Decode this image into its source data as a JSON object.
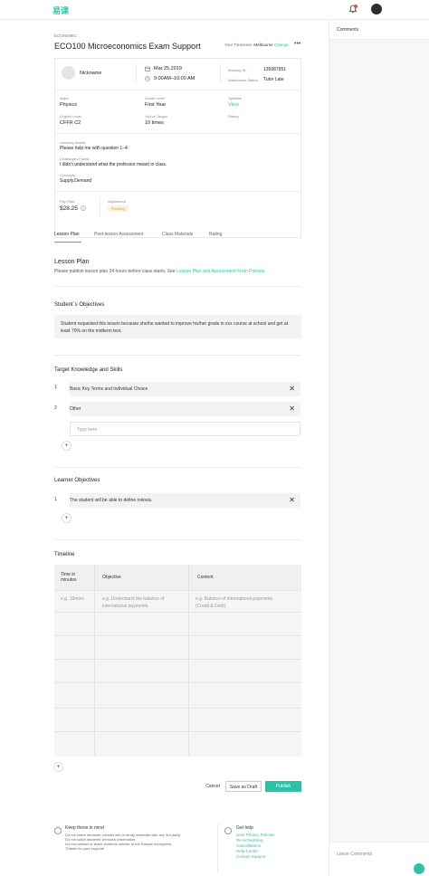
{
  "app": {
    "logo": "易课"
  },
  "header": {
    "breadcrumb": "ECONOMIC",
    "title": "ECO100 Microeconomics Exam Support",
    "timezone_label": "Your Timezone:",
    "timezone_value": "Melbourne",
    "timezone_change": "Change",
    "more": "•••"
  },
  "card": {
    "nickname": "Nickname",
    "date": "Mar 25,2019",
    "time": "9:00AM–10:00 AM",
    "booking_label": "Booking ID:",
    "booking_id": "135687951",
    "attendance_label": "Attendance Status:",
    "attendance": "Tutor Late",
    "major_label": "Major",
    "major": "Physics",
    "grade_label": "Grade Level",
    "grade": "First Year",
    "syllabus_label": "Syllabus",
    "syllabus": "View",
    "english_label": "English Level",
    "english": "CFFR C2",
    "taught_label": "You've Taught",
    "taught": "10 times",
    "rating_label": "Rating",
    "needs_label": "Learning Needs",
    "needs": "Please help me with question 1–4.",
    "challenges_label": "Challenges Faced",
    "challenges": "I didn’t understand what the professor meant in class.",
    "concepts_label": "Concepts",
    "concepts": "Supply,Demand",
    "pay_label": "Pay Rate",
    "pay": "$28.25",
    "adjust_label": "Adjustment",
    "adjust_status": "Pending"
  },
  "tabs": [
    "Lesson Plan",
    "Post-lesson Assessment",
    "Class Materials",
    "Rating"
  ],
  "lesson_plan": {
    "title": "Lesson Plan",
    "desc": "Please publish lesson plan 24 hours before class starts. See",
    "desc_link": "Lesson Plan and Assessment From Policies"
  },
  "objectives": {
    "title": "Student`s Objectives",
    "text": "Student requested this lesson because she/he wanted to improve his/her grade in xxx course at school and get at least 70% on the midterm test."
  },
  "knowledge": {
    "title": "Target Knowledge and Skills",
    "items": [
      {
        "num": "1",
        "text": "Basic Key Terms and Individual Choice"
      },
      {
        "num": "2",
        "text": "Other"
      }
    ],
    "placeholder": "Type here"
  },
  "learner": {
    "title": "Learner Objectives",
    "items": [
      {
        "num": "1",
        "text": "The student will be able to define mitosis."
      }
    ]
  },
  "timeline": {
    "title": "Timeline",
    "col_time": "Time in minutes",
    "col_objective": "Objective",
    "col_content": "Content",
    "ph_time": "e.g. 10mins",
    "ph_objective": "e.g. Understand the balance of international payments.",
    "ph_content": "e.g. Balance of international payments (Credit & Debt)."
  },
  "actions": {
    "cancel": "Cancel",
    "draft": "Save as Draft",
    "publish": "Publish"
  },
  "footer": {
    "keep_title": "Keep these in mind",
    "keep_lines": [
      "Do not share students' contact info or study materials with any 3rd party.",
      "Do not solicit students' personal information.",
      "Do not contact or teach students outside of the Easyke ecosystem.",
      "Thanks for your support!"
    ],
    "help_title": "Get help",
    "help_links": [
      "User Privacy Policies",
      "Re-Scheduling",
      "Cancellations",
      "Help Center",
      "Contact Support"
    ]
  },
  "sidebar": {
    "title": "Comments",
    "leave": "Leave Comments"
  },
  "colors": {
    "accent": "#2ec2a5"
  }
}
